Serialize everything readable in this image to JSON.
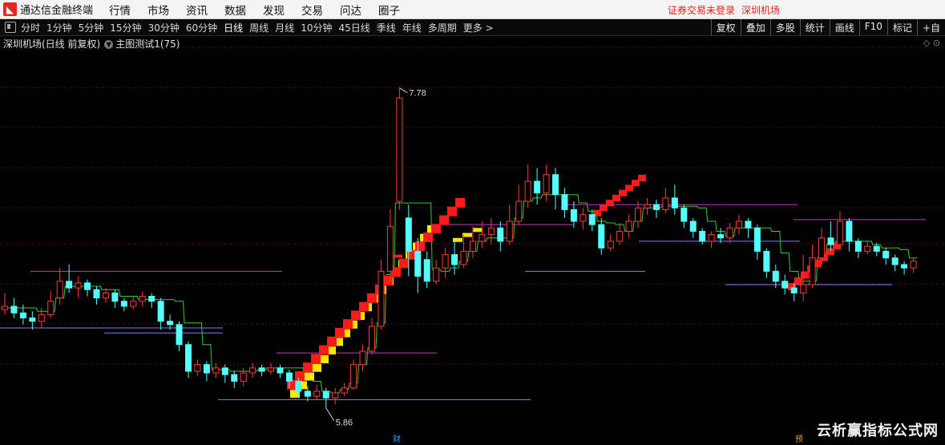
{
  "app": {
    "name": "通达信金融终端",
    "logo_char": "◣"
  },
  "menu": [
    "行情",
    "市场",
    "资讯",
    "数据",
    "发现",
    "交易",
    "问达",
    "圈子"
  ],
  "status": {
    "login": "证券交易未登录",
    "stock": "深圳机场"
  },
  "periods": [
    "分时",
    "1分钟",
    "5分钟",
    "15分钟",
    "30分钟",
    "60分钟",
    "日线",
    "周线",
    "月线",
    "10分钟",
    "45日线",
    "季线",
    "年线",
    "多周期",
    "更多 >"
  ],
  "active_period": "日线",
  "right_tools": [
    "复权",
    "叠加",
    "多股",
    "统计",
    "画线",
    "F10",
    "标记",
    "+自"
  ],
  "subhead": {
    "title": "深圳机场(日线 前复权)",
    "indicator": "主图测试1(75)"
  },
  "corner_icons": "◇ ⊙",
  "annotations": {
    "high_label": "7.78",
    "low_label": "5.86"
  },
  "markers": {
    "fin": "财",
    "pre": "预"
  },
  "watermark": "云析赢指标公式网",
  "colors": {
    "up": "#ff3b3b",
    "down": "#54ffff",
    "red_blocks": "#ff1a1a",
    "yellow_blocks": "#ffe600",
    "green_step": "#33cc33",
    "magenta_line": "#cc33cc",
    "blue_line": "#7f7fff",
    "grid": "#8b1a1a"
  },
  "chart_data": {
    "type": "candlestick",
    "ylim": [
      5.7,
      8.0
    ],
    "high": 7.78,
    "low": 5.86,
    "candles": [
      [
        6.45,
        6.47,
        6.42,
        6.55
      ],
      [
        6.47,
        6.43,
        6.4,
        6.52
      ],
      [
        6.43,
        6.4,
        6.36,
        6.48
      ],
      [
        6.4,
        6.38,
        6.33,
        6.44
      ],
      [
        6.38,
        6.42,
        6.34,
        6.46
      ],
      [
        6.42,
        6.5,
        6.4,
        6.56
      ],
      [
        6.52,
        6.62,
        6.48,
        6.7
      ],
      [
        6.62,
        6.58,
        6.55,
        6.72
      ],
      [
        6.58,
        6.61,
        6.52,
        6.65
      ],
      [
        6.61,
        6.57,
        6.53,
        6.63
      ],
      [
        6.57,
        6.52,
        6.48,
        6.59
      ],
      [
        6.52,
        6.55,
        6.49,
        6.58
      ],
      [
        6.55,
        6.5,
        6.46,
        6.57
      ],
      [
        6.5,
        6.47,
        6.44,
        6.52
      ],
      [
        6.47,
        6.5,
        6.45,
        6.53
      ],
      [
        6.5,
        6.53,
        6.47,
        6.56
      ],
      [
        6.53,
        6.5,
        6.46,
        6.55
      ],
      [
        6.5,
        6.38,
        6.33,
        6.52
      ],
      [
        6.38,
        6.36,
        6.33,
        6.42
      ],
      [
        6.36,
        6.24,
        6.2,
        6.38
      ],
      [
        6.24,
        6.08,
        6.04,
        6.26
      ],
      [
        6.08,
        6.12,
        6.05,
        6.15
      ],
      [
        6.12,
        6.07,
        6.02,
        6.14
      ],
      [
        6.07,
        6.1,
        6.04,
        6.13
      ],
      [
        6.1,
        6.06,
        6.01,
        6.12
      ],
      [
        6.06,
        6.02,
        5.98,
        6.08
      ],
      [
        6.02,
        6.07,
        5.99,
        6.1
      ],
      [
        6.07,
        6.1,
        6.04,
        6.13
      ],
      [
        6.1,
        6.08,
        6.05,
        6.12
      ],
      [
        6.08,
        6.1,
        6.06,
        6.13
      ],
      [
        6.1,
        6.07,
        6.04,
        6.12
      ],
      [
        6.07,
        6.02,
        5.98,
        6.09
      ],
      [
        6.02,
        5.96,
        5.92,
        6.04
      ],
      [
        5.96,
        5.93,
        5.9,
        5.99
      ],
      [
        5.93,
        5.96,
        5.91,
        6.0
      ],
      [
        5.96,
        5.92,
        5.86,
        5.98
      ],
      [
        5.92,
        5.95,
        5.88,
        5.98
      ],
      [
        5.95,
        5.98,
        5.93,
        6.01
      ],
      [
        5.98,
        6.12,
        5.97,
        6.15
      ],
      [
        6.12,
        6.2,
        6.08,
        6.24
      ],
      [
        6.2,
        6.35,
        6.18,
        6.4
      ],
      [
        6.35,
        6.68,
        6.33,
        6.75
      ],
      [
        6.68,
        6.95,
        6.62,
        7.05
      ],
      [
        7.1,
        7.72,
        7.05,
        7.78
      ],
      [
        7.0,
        6.8,
        6.65,
        7.08
      ],
      [
        6.8,
        6.65,
        6.55,
        6.88
      ],
      [
        6.75,
        6.62,
        6.58,
        6.8
      ],
      [
        6.62,
        6.7,
        6.6,
        6.75
      ],
      [
        6.7,
        6.78,
        6.64,
        6.82
      ],
      [
        6.78,
        6.72,
        6.66,
        6.86
      ],
      [
        6.72,
        6.8,
        6.7,
        6.9
      ],
      [
        6.8,
        6.86,
        6.76,
        6.95
      ],
      [
        6.86,
        6.9,
        6.82,
        6.98
      ],
      [
        6.9,
        6.94,
        6.84,
        7.0
      ],
      [
        6.94,
        6.86,
        6.8,
        6.98
      ],
      [
        6.86,
        6.98,
        6.84,
        7.08
      ],
      [
        6.98,
        7.1,
        6.96,
        7.2
      ],
      [
        7.1,
        7.22,
        7.06,
        7.32
      ],
      [
        7.22,
        7.15,
        7.08,
        7.3
      ],
      [
        7.15,
        7.26,
        7.1,
        7.32
      ],
      [
        7.26,
        7.14,
        7.05,
        7.3
      ],
      [
        7.14,
        7.05,
        7.0,
        7.18
      ],
      [
        7.05,
        6.98,
        6.94,
        7.1
      ],
      [
        6.98,
        7.02,
        6.93,
        7.06
      ],
      [
        7.02,
        6.96,
        6.92,
        7.05
      ],
      [
        6.96,
        6.82,
        6.78,
        7.0
      ],
      [
        6.82,
        6.86,
        6.8,
        6.9
      ],
      [
        6.86,
        6.92,
        6.84,
        6.97
      ],
      [
        6.92,
        6.98,
        6.88,
        7.02
      ],
      [
        6.98,
        7.06,
        6.94,
        7.1
      ],
      [
        7.06,
        7.08,
        7.02,
        7.12
      ],
      [
        7.08,
        7.05,
        7.0,
        7.11
      ],
      [
        7.05,
        7.12,
        7.03,
        7.18
      ],
      [
        7.12,
        7.06,
        7.02,
        7.2
      ],
      [
        7.06,
        6.98,
        6.94,
        7.08
      ],
      [
        6.98,
        6.92,
        6.88,
        7.0
      ],
      [
        6.92,
        6.86,
        6.84,
        6.94
      ],
      [
        6.86,
        6.9,
        6.82,
        6.92
      ],
      [
        6.9,
        6.88,
        6.85,
        6.94
      ],
      [
        6.88,
        6.94,
        6.85,
        6.97
      ],
      [
        6.94,
        6.98,
        6.9,
        7.02
      ],
      [
        6.98,
        6.94,
        6.88,
        7.0
      ],
      [
        6.94,
        6.8,
        6.75,
        6.96
      ],
      [
        6.8,
        6.68,
        6.64,
        6.82
      ],
      [
        6.68,
        6.62,
        6.58,
        6.72
      ],
      [
        6.62,
        6.58,
        6.54,
        6.66
      ],
      [
        6.58,
        6.55,
        6.5,
        6.61
      ],
      [
        6.55,
        6.6,
        6.5,
        6.78
      ],
      [
        6.6,
        6.76,
        6.58,
        6.84
      ],
      [
        6.76,
        6.88,
        6.72,
        6.94
      ],
      [
        6.88,
        6.84,
        6.8,
        6.98
      ],
      [
        6.84,
        6.98,
        6.82,
        7.04
      ],
      [
        6.98,
        6.86,
        6.8,
        7.0
      ],
      [
        6.86,
        6.8,
        6.76,
        6.88
      ],
      [
        6.8,
        6.83,
        6.78,
        6.86
      ],
      [
        6.83,
        6.8,
        6.77,
        6.85
      ],
      [
        6.8,
        6.76,
        6.72,
        6.82
      ],
      [
        6.76,
        6.72,
        6.68,
        6.78
      ],
      [
        6.72,
        6.7,
        6.66,
        6.74
      ],
      [
        6.7,
        6.74,
        6.67,
        6.76
      ]
    ]
  }
}
